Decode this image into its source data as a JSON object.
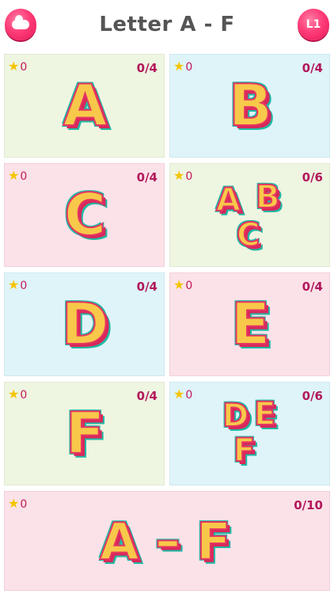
{
  "header": {
    "title": "Letter A - F",
    "back_icon": "cloud-icon",
    "level_label": "L1"
  },
  "cards": [
    {
      "stars": "0",
      "progress": "0/4",
      "glyph": "A"
    },
    {
      "stars": "0",
      "progress": "0/4",
      "glyph": "B"
    },
    {
      "stars": "0",
      "progress": "0/4",
      "glyph": "C"
    },
    {
      "stars": "0",
      "progress": "0/6",
      "glyph_a": "A",
      "glyph_b": "B",
      "glyph_c": "C"
    },
    {
      "stars": "0",
      "progress": "0/4",
      "glyph": "D"
    },
    {
      "stars": "0",
      "progress": "0/4",
      "glyph": "E"
    },
    {
      "stars": "0",
      "progress": "0/4",
      "glyph": "F"
    },
    {
      "stars": "0",
      "progress": "0/6",
      "glyph_a": "D",
      "glyph_b": "E",
      "glyph_c": "F"
    },
    {
      "stars": "0",
      "progress": "0/10",
      "glyph_left": "A",
      "glyph_dash": "–",
      "glyph_right": "F"
    }
  ]
}
